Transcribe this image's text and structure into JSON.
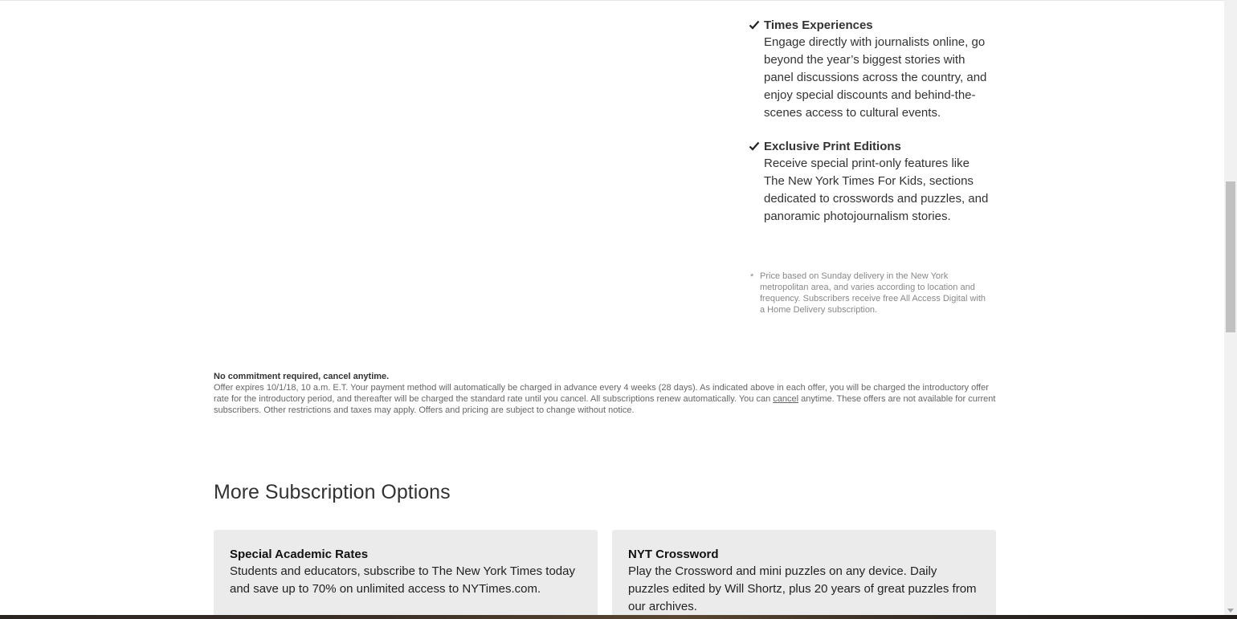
{
  "benefits": [
    {
      "title": "Times Experiences",
      "description": "Engage directly with journalists online, go beyond the year’s biggest stories with panel discussions across the country, and enjoy special discounts and behind-the-scenes access to cultural events."
    },
    {
      "title": "Exclusive Print Editions",
      "description": "Receive special print-only features like The New York Times For Kids, sections dedicated to crosswords and puzzles, and panoramic photojournalism stories."
    }
  ],
  "footnote": {
    "mark": "*",
    "text": "Price based on Sunday delivery in the New York metropolitan area, and varies according to location and frequency. Subscribers receive free All Access Digital with a Home Delivery subscription."
  },
  "legal": {
    "heading": "No commitment required, cancel anytime.",
    "text_before_link": "Offer expires 10/1/18, 10 a.m. E.T. Your payment method will automatically be charged in advance every 4 weeks (28 days). As indicated above in each offer, you will be charged the introductory offer rate for the introductory period, and thereafter will be charged the standard rate until you cancel. All subscriptions renew automatically. You can ",
    "link_label": "cancel",
    "text_after_link": " anytime. These offers are not available for current subscribers. Other restrictions and taxes may apply. Offers and pricing are subject to change without notice."
  },
  "more_options": {
    "title": "More Subscription Options",
    "cards": [
      {
        "title": "Special Academic Rates",
        "description": "Students and educators, subscribe to The New York Times today and save up to 70% on unlimited access to NYTimes.com."
      },
      {
        "title": "NYT Crossword",
        "description": "Play the Crossword and mini puzzles on any device. Daily puzzles edited by Will Shortz, plus 20 years of great puzzles from our archives."
      }
    ]
  },
  "icons": {
    "benefit_check": "check-icon"
  },
  "colors": {
    "card_background": "#ebebeb",
    "footnote_text": "#888888",
    "body_text": "#333333"
  }
}
